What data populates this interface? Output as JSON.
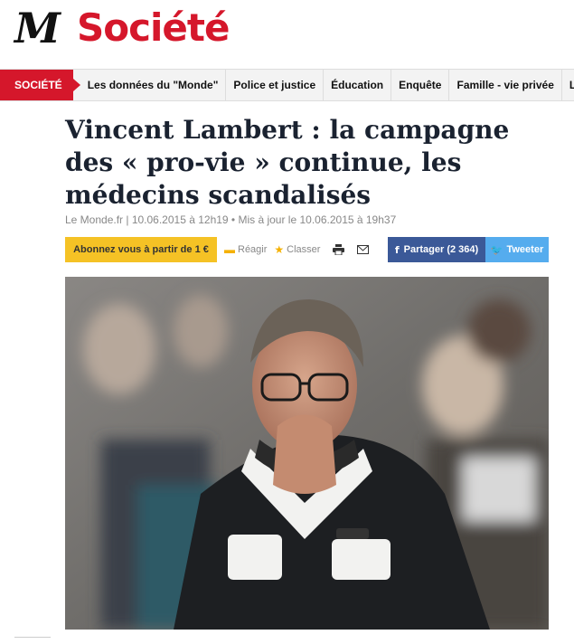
{
  "header": {
    "logo": "M",
    "section_title": "Société"
  },
  "nav": {
    "active": "SOCIÉTÉ",
    "items": [
      "Les données du \"Monde\"",
      "Police et justice",
      "Éducation",
      "Enquête",
      "Famille - vie privée",
      "L"
    ]
  },
  "article": {
    "headline": "Vincent Lambert : la campagne des « pro-vie » continue, les médecins scandalisés",
    "byline": "Le Monde.fr | 10.06.2015 à 12h19 • Mis à jour le 10.06.2015 à 19h37"
  },
  "actions": {
    "subscribe": "Abonnez vous à partir de 1 €",
    "react": "Réagir",
    "save": "Classer",
    "share_facebook": "Partager (2 364)",
    "tweet": "Tweeter"
  },
  "icons": {
    "comment": "comment-icon",
    "star": "star-icon",
    "print": "print-icon",
    "mail": "mail-icon",
    "facebook": "facebook-icon",
    "twitter": "twitter-icon"
  },
  "colors": {
    "brand_red": "#d5172b",
    "subscribe_yellow": "#f5c225",
    "facebook_blue": "#3b5998",
    "twitter_blue": "#55acee"
  }
}
